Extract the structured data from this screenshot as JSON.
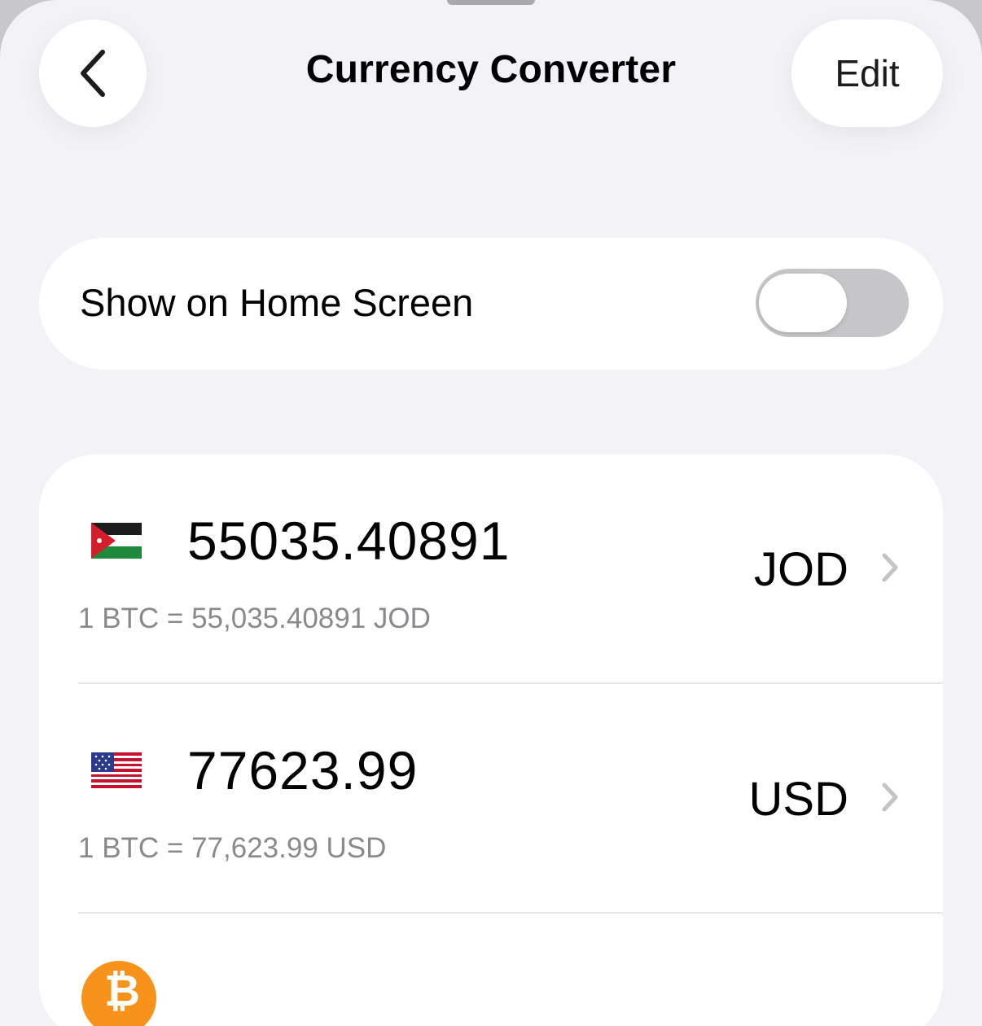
{
  "header": {
    "title": "Currency Converter",
    "back_icon": "chevron-left-icon",
    "edit_label": "Edit"
  },
  "home_screen": {
    "label": "Show on Home Screen",
    "enabled": false
  },
  "conversions": [
    {
      "flag": "jordan-flag-icon",
      "amount": "55035.40891",
      "currency": "JOD",
      "rate": "1 BTC = 55,035.40891 JOD"
    },
    {
      "flag": "us-flag-icon",
      "amount": "77623.99",
      "currency": "USD",
      "rate": "1 BTC = 77,623.99 USD"
    }
  ],
  "colors": {
    "background": "#f2f2f7",
    "card": "#ffffff",
    "toggle_off": "#c6c6c8",
    "secondary_text": "#8a8a8e",
    "bitcoin_orange": "#f7931a"
  }
}
